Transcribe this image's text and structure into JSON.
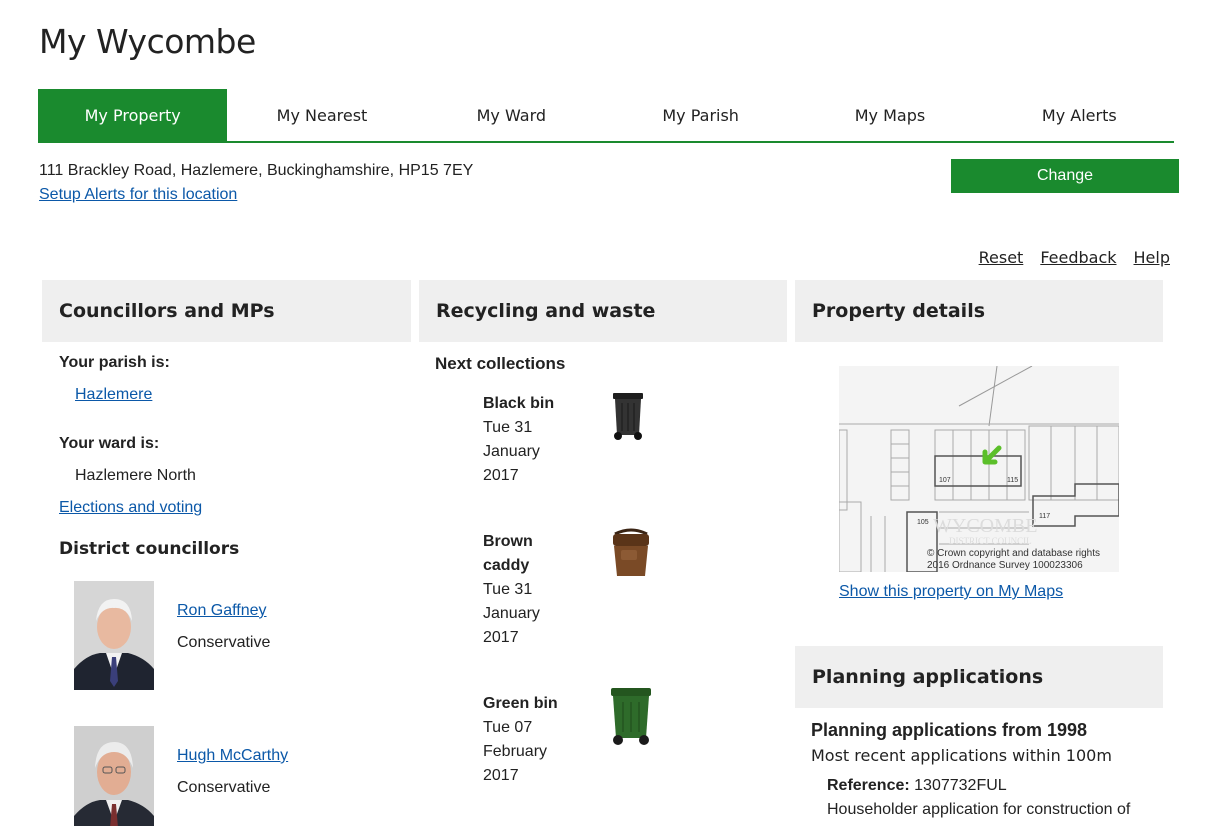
{
  "site": {
    "title": "My Wycombe"
  },
  "tabs": [
    "My Property",
    "My Nearest",
    "My Ward",
    "My Parish",
    "My Maps",
    "My Alerts"
  ],
  "location": {
    "address": "111 Brackley Road, Hazlemere, Buckinghamshire, HP15 7EY",
    "setup_alerts": "Setup Alerts for this location",
    "change_label": "Change"
  },
  "util_links": {
    "reset": "Reset",
    "feedback": "Feedback",
    "help": "Help"
  },
  "councillors": {
    "title": "Councillors and MPs",
    "parish_label": "Your parish is:",
    "parish": "Hazlemere",
    "ward_label": "Your ward is:",
    "ward": "Hazlemere North",
    "elections_link": "Elections and voting",
    "district_title": "District councillors",
    "people": [
      {
        "name": "Ron Gaffney",
        "party": "Conservative"
      },
      {
        "name": "Hugh McCarthy",
        "party": "Conservative"
      }
    ]
  },
  "recycling": {
    "title": "Recycling and waste",
    "next_title": "Next collections",
    "bins": [
      {
        "name": "Black bin",
        "date_lines": [
          "Tue 31",
          "January",
          "2017"
        ],
        "color": "#2b2b2b"
      },
      {
        "name_lines": [
          "Brown",
          "caddy"
        ],
        "date_lines": [
          "Tue 31",
          "January",
          "2017"
        ],
        "color": "#6b3d1e"
      },
      {
        "name": "Green bin",
        "date_lines": [
          "Tue 07",
          "February",
          "2017"
        ],
        "color": "#2e6b2a"
      }
    ]
  },
  "property": {
    "title": "Property details",
    "map_labels": {
      "plot_107": "107",
      "plot_115": "115",
      "plot_117": "117",
      "plot_105": "105"
    },
    "map_watermark_lines": [
      "WYCOMBE",
      "DISTRICT COUNCIL"
    ],
    "map_copyright_lines": [
      "© Crown copyright and database rights",
      "2016 Ordnance Survey 100023306"
    ],
    "show_link": "Show this property on My Maps"
  },
  "planning": {
    "title": "Planning applications",
    "from_title": "Planning applications from 1998",
    "subtitle": "Most recent applications within 100m",
    "reference_label": "Reference:",
    "reference_value": "1307732FUL",
    "description": "Householder application for construction of"
  },
  "colors": {
    "accent_green": "#1a8a2e",
    "link_blue": "#0b58a8",
    "panel_grey": "#efefef"
  }
}
